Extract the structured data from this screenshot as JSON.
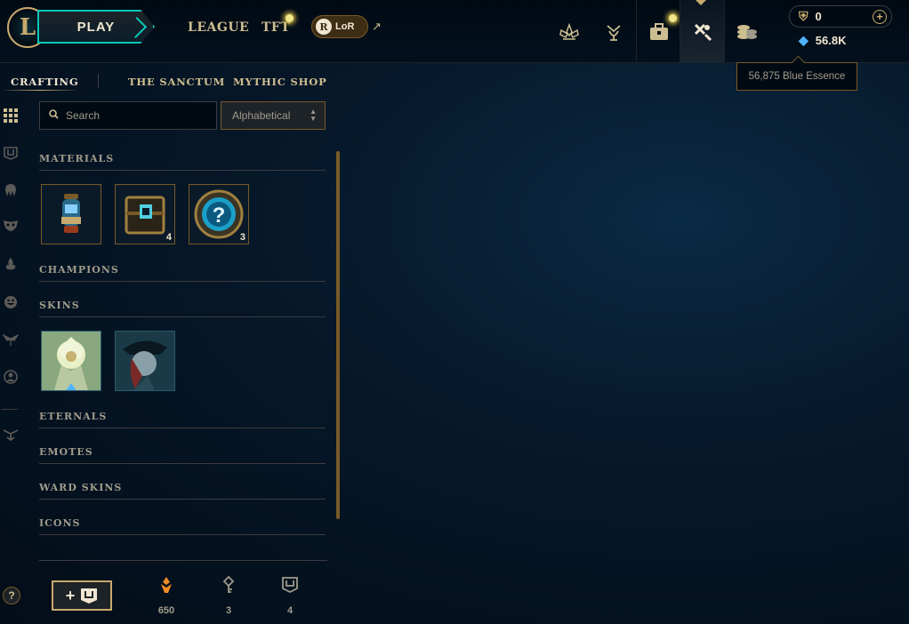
{
  "nav": {
    "play_label": "PLAY",
    "links": [
      "LEAGUE",
      "TFT"
    ],
    "lor_label": "LoR",
    "lor_badge": "R"
  },
  "wallet": {
    "rp_value": "0",
    "be_value": "56.8K",
    "tooltip": "56,875 Blue Essence"
  },
  "subtabs": [
    "CRAFTING",
    "THE SANCTUM",
    "MYTHIC SHOP"
  ],
  "toolbar": {
    "search_placeholder": "Search",
    "sort_value": "Alphabetical"
  },
  "sections": [
    "MATERIALS",
    "CHAMPIONS",
    "SKINS",
    "ETERNALS",
    "EMOTES",
    "WARD SKINS",
    "ICONS"
  ],
  "materials": [
    {
      "icon": "orb-lantern-icon",
      "count": ""
    },
    {
      "icon": "hextech-chest-icon",
      "count": "4"
    },
    {
      "icon": "mystery-orb-icon",
      "count": "3"
    }
  ],
  "skins": [
    {
      "icon": "skin-shard-light-icon"
    },
    {
      "icon": "skin-shard-dark-icon"
    }
  ],
  "footer": {
    "help": "?",
    "stats": [
      {
        "icon": "orange-essence-icon",
        "value": "650",
        "color": "#f08a24"
      },
      {
        "icon": "key-icon",
        "value": "3",
        "color": "#a09b8c"
      },
      {
        "icon": "chest-icon",
        "value": "4",
        "color": "#a09b8c"
      }
    ]
  },
  "colors": {
    "gold": "#c8aa6e",
    "teal": "#0ac8b9",
    "blue_essence": "#4fb3ff",
    "orange_essence": "#f08a24"
  }
}
